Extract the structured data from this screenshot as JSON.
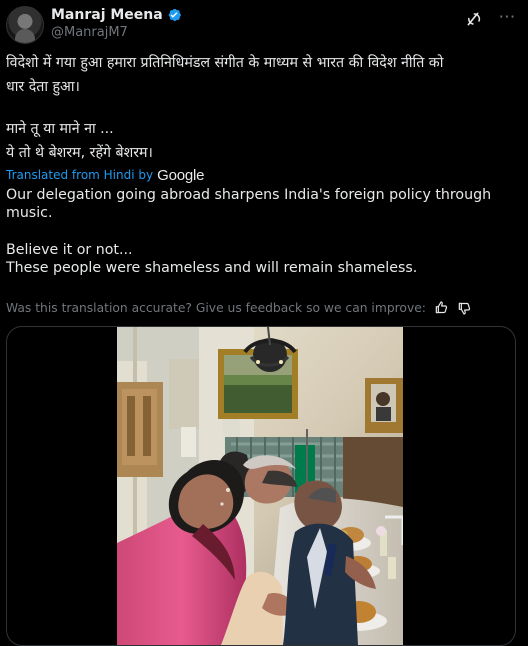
{
  "post": {
    "author": {
      "name": "Manraj Meena",
      "handle": "@ManrajM7",
      "avatar_icon": "avatar-profile-photo",
      "verified_icon": "blue-verified-badge-icon",
      "verified_color": "#1d9bf0"
    },
    "actions": {
      "grok_icon": "grok-icon",
      "more_icon": "more-icon"
    },
    "original_lines": [
      "विदेशो में गया हुआ हमारा प्रतिनिधिमंडल संगीत के माध्यम से भारत की विदेश नीति को",
      "धार देता हुआ।",
      "माने तू या माने ना ...",
      "ये तो थे बेशरम, रहेंगे बेशरम।"
    ],
    "translation": {
      "by_label": "Translated from Hindi by",
      "provider": "Google",
      "lines": [
        "Our delegation going abroad sharpens India's foreign policy through",
        "music.",
        "Believe it or not...",
        "These people were shameless and will remain shameless."
      ],
      "feedback_label": "Was this translation accurate? Give us feedback so we can improve:",
      "thumbs_up_icon": "thumbs-up-icon",
      "thumbs_down_icon": "thumbs-down-icon"
    },
    "media": {
      "type": "video",
      "description_icon": "video-thumbnail",
      "border_color": "#2f3336"
    }
  },
  "colors": {
    "background": "#000000",
    "text": "#e7e9ea",
    "muted": "#71767b",
    "link": "#1d9bf0"
  }
}
